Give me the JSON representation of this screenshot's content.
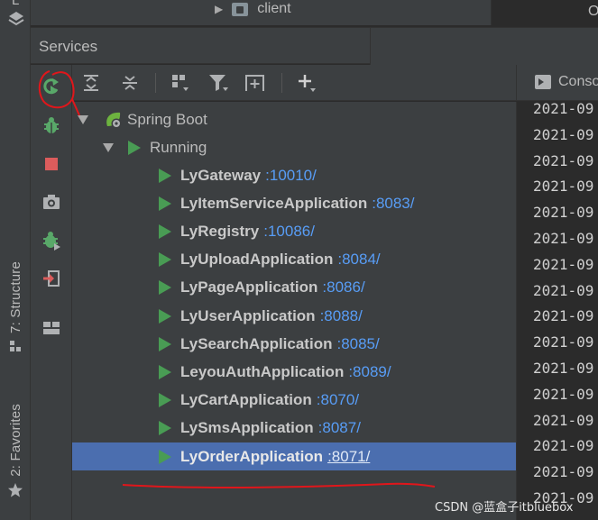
{
  "top": {
    "client_label": "client",
    "right_tab_partial": "O"
  },
  "left_strip": {
    "top_partial": "L",
    "structure_label": "7: Structure",
    "favorites_label": "2: Favorites"
  },
  "services": {
    "title": "Services"
  },
  "tree": {
    "root": "Spring Boot",
    "group": "Running",
    "items": [
      {
        "name": "LyGateway",
        "port": ":10010/"
      },
      {
        "name": "LyItemServiceApplication",
        "port": ":8083/"
      },
      {
        "name": "LyRegistry",
        "port": ":10086/"
      },
      {
        "name": "LyUploadApplication",
        "port": ":8084/"
      },
      {
        "name": "LyPageApplication",
        "port": ":8086/"
      },
      {
        "name": "LyUserApplication",
        "port": ":8088/"
      },
      {
        "name": "LySearchApplication",
        "port": ":8085/"
      },
      {
        "name": "LeyouAuthApplication",
        "port": ":8089/"
      },
      {
        "name": "LyCartApplication",
        "port": ":8070/"
      },
      {
        "name": "LySmsApplication",
        "port": ":8087/"
      },
      {
        "name": "LyOrderApplication",
        "port": ":8071/"
      }
    ],
    "selected_index": 10
  },
  "console": {
    "tab_label": "Conso",
    "lines": [
      "2021-09",
      "2021-09",
      "2021-09",
      "2021-09",
      "2021-09",
      "2021-09",
      "2021-09",
      "2021-09",
      "2021-09",
      "2021-09",
      "2021-09",
      "2021-09",
      "2021-09",
      "2021-09",
      "2021-09",
      "2021-09"
    ]
  },
  "watermark": "CSDN @蓝盒子itbluebox",
  "colors": {
    "panel_bg": "#3c3f41",
    "editor_bg": "#2b2b2b",
    "selection": "#4b6eaf",
    "run_green": "#499c54",
    "link_blue": "#589df6",
    "annotation_red": "#e0161b"
  }
}
